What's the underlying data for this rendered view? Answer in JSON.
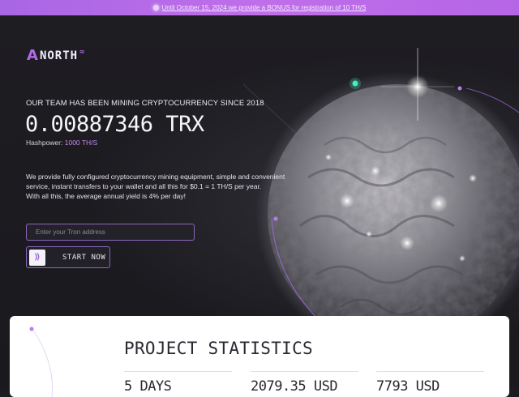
{
  "banner": {
    "text": "Until October 15, 2024 we provide a BONUS for registration of 10 TH/S"
  },
  "logo": {
    "text": "NORTH",
    "mark": "A"
  },
  "hero": {
    "subtitle": "OUR TEAM HAS BEEN MINING CRYPTOCURRENCY SINCE 2018",
    "amount": "0.00887346 TRX",
    "hashpower_label": "Hashpower:",
    "hashpower_value": "1000 TH/S",
    "description": [
      "We provide fully configured cryptocurrency mining equipment, simple and convenient service, instant transfers to your wallet and all this for $0.1 = 1 TH/S per year.",
      "With all this, the average annual yield is 4% per day!"
    ]
  },
  "form": {
    "address_placeholder": "Enter your Tron address",
    "address_value": "",
    "start_label": "START NOW",
    "start_icon": "chevrons-right-icon"
  },
  "stats": {
    "title": "PROJECT STATISTICS",
    "items": [
      {
        "value": "5 DAYS"
      },
      {
        "value": "2079.35 USD"
      },
      {
        "value": "7793 USD"
      }
    ]
  },
  "colors": {
    "accent": "#b16be8",
    "banner": "#b96ae7",
    "background": "#1c1b20",
    "card": "#ffffff"
  }
}
